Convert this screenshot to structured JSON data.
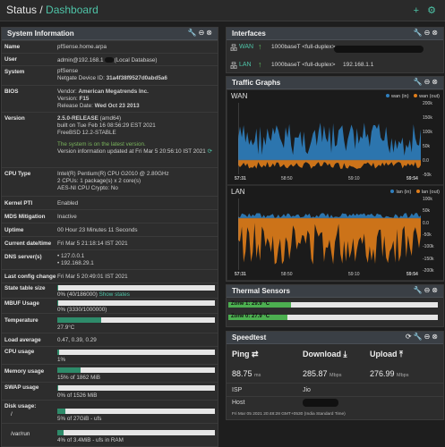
{
  "header": {
    "title": "Status /",
    "crumb": "Dashboard",
    "add_icon": "+",
    "settings_icon": "⚙"
  },
  "colors": {
    "accent": "#4ec3a7",
    "wan_in": "#2f7fbf",
    "wan_out": "#e07d1a",
    "bar_fill": "#2e8b6a"
  },
  "sysinfo": {
    "title": "System Information",
    "name_label": "Name",
    "name_value": "pfSense.home.arpa",
    "user_label": "User",
    "user_value": "admin@192.168.1",
    "user_suffix": "(Local Database)",
    "system_label": "System",
    "system_line1": "pfSense",
    "system_line2_prefix": "Netgate Device ID: ",
    "system_device_id": "31a4f38f9527d0abd5a6",
    "bios_label": "BIOS",
    "bios_vendor_prefix": "Vendor: ",
    "bios_vendor": "American Megatrends Inc.",
    "bios_version_prefix": "Version: ",
    "bios_version": "F15",
    "bios_date_prefix": "Release Date: ",
    "bios_date": "Wed Oct 23 2013",
    "version_label": "Version",
    "version_main": "2.5.0-RELEASE",
    "version_arch": " (amd64)",
    "version_built": "built on Tue Feb 16 08:56:29 EST 2021",
    "version_freebsd": "FreeBSD 12.2-STABLE",
    "version_latest": "The system is on the latest version.",
    "version_updated": "Version information updated at Fri Mar 5 20:56:10 IST 2021",
    "cpu_label": "CPU Type",
    "cpu_line1": "Intel(R) Pentium(R) CPU G2010 @ 2.80GHz",
    "cpu_line2": "2 CPUs: 1 package(s) x 2 core(s)",
    "cpu_line3": "AES-NI CPU Crypto: No",
    "pti_label": "Kernel PTI",
    "pti_value": "Enabled",
    "mds_label": "MDS Mitigation",
    "mds_value": "Inactive",
    "uptime_label": "Uptime",
    "uptime_value": "00 Hour 23 Minutes 11 Seconds",
    "datetime_label": "Current date/time",
    "datetime_value": "Fri Mar 5 21:18:14 IST 2021",
    "dns_label": "DNS server(s)",
    "dns1": "127.0.0.1",
    "dns2": "192.168.29.1",
    "lastchange_label": "Last config change",
    "lastchange_value": "Fri Mar 5 20:49:01 IST 2021",
    "state_label": "State table size",
    "state_value": "0% (40/186000)",
    "state_link": "Show states",
    "state_pct": 0,
    "mbuf_label": "MBUF Usage",
    "mbuf_value": "0% (3330/1000000)",
    "mbuf_pct": 0,
    "temp_label": "Temperature",
    "temp_value": "27.9°C",
    "temp_pct": 28,
    "load_label": "Load average",
    "load_value": "0.47, 0.39, 0.29",
    "cpu_usage_label": "CPU usage",
    "cpu_usage_value": "1%",
    "cpu_usage_pct": 1,
    "mem_label": "Memory usage",
    "mem_value": "15% of 1862 MiB",
    "mem_pct": 15,
    "swap_label": "SWAP usage",
    "swap_value": "0% of 1526 MiB",
    "swap_pct": 0,
    "disk_label": "Disk usage:",
    "disk_root_label": "/",
    "disk_root_value": "5% of 27GiB - ufs",
    "disk_root_pct": 5,
    "disk_run_label": "/var/run",
    "disk_run_value": "4% of 3.4MiB - ufs in RAM",
    "disk_run_pct": 4
  },
  "interfaces": {
    "title": "Interfaces",
    "rows": [
      {
        "name": "WAN",
        "media": "1000baseT <full-duplex>",
        "ip": ""
      },
      {
        "name": "LAN",
        "media": "1000baseT <full-duplex>",
        "ip": "192.168.1.1"
      }
    ]
  },
  "traffic": {
    "title": "Traffic Graphs",
    "wan": {
      "name": "WAN",
      "legend_in": "wan (in)",
      "legend_out": "wan (out)",
      "yticks": [
        "200k",
        "150k",
        "100k",
        "50k",
        "0.0",
        "-50k"
      ],
      "xticks": [
        "57:31",
        "58:50",
        "59:10",
        "59:54"
      ]
    },
    "lan": {
      "name": "LAN",
      "legend_in": "lan (in)",
      "legend_out": "lan (out)",
      "yticks": [
        "100k",
        "50k",
        "0.0",
        "-50k",
        "-100k",
        "-150k",
        "-200k"
      ],
      "xticks": [
        "57:31",
        "58:50",
        "59:10",
        "59:54"
      ]
    }
  },
  "chart_data": [
    {
      "type": "area",
      "title": "WAN",
      "series": [
        {
          "name": "wan (in)"
        },
        {
          "name": "wan (out)"
        }
      ]
    },
    {
      "type": "area",
      "title": "LAN",
      "series": [
        {
          "name": "lan (in)"
        },
        {
          "name": "lan (out)"
        }
      ]
    }
  ],
  "thermal": {
    "title": "Thermal Sensors",
    "zone1": "Zone 1: 29.9 °C",
    "zone0": "Zone 0: 27.9 °C",
    "zone1_pct": 30,
    "zone0_pct": 28
  },
  "speedtest": {
    "title": "Speedtest",
    "ping_label": "Ping",
    "download_label": "Download",
    "upload_label": "Upload",
    "ping_value": "88.75",
    "ping_unit": "ms",
    "download_value": "285.87",
    "download_unit": "Mbps",
    "upload_value": "276.99",
    "upload_unit": "Mbps",
    "isp_label": "ISP",
    "isp_value": "Jio",
    "host_label": "Host",
    "timestamp": "Fri Mar 05 2021 20:48:28 GMT+0530 (India Standard Time)"
  }
}
